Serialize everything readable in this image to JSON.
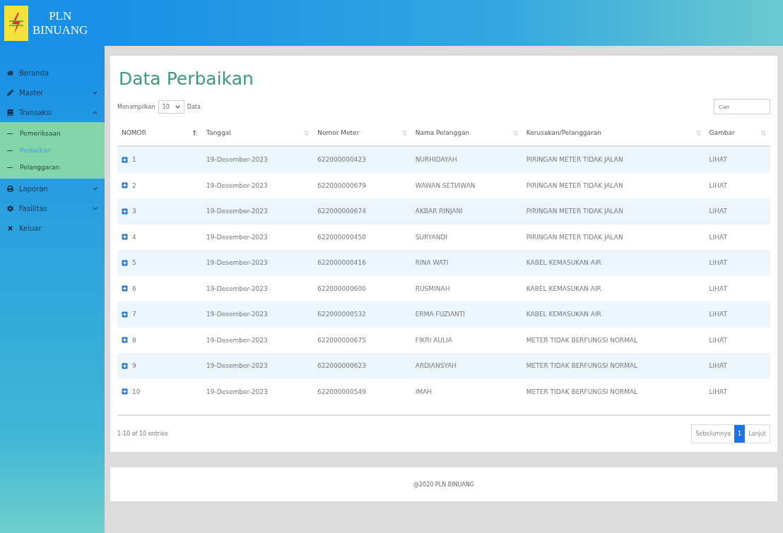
{
  "brand": {
    "line1": "PLN",
    "line2": "BINUANG"
  },
  "sidebar": {
    "items": [
      {
        "label": "Beranda"
      },
      {
        "label": "Master",
        "expanded": false
      },
      {
        "label": "Transaksi",
        "expanded": true,
        "children": [
          {
            "label": "Pemeriksaan",
            "selected": false
          },
          {
            "label": "Perbaikan",
            "selected": true
          },
          {
            "label": "Pelanggaran",
            "selected": false
          }
        ]
      },
      {
        "label": "Laporan",
        "expanded": false
      },
      {
        "label": "Fasilitas",
        "expanded": false
      },
      {
        "label": "Keluar"
      }
    ]
  },
  "page_title": "Data Perbaikan",
  "length_control": {
    "before": "Menampilkan",
    "value": "10",
    "after": "Data"
  },
  "search": {
    "placeholder": "Cari"
  },
  "table": {
    "columns": [
      {
        "label": "NOMOR",
        "sorted": true
      },
      {
        "label": "Tanggal",
        "sorted": false
      },
      {
        "label": "Nomor Meter",
        "sorted": false
      },
      {
        "label": "Nama Pelanggan",
        "sorted": false
      },
      {
        "label": "Kerusakan/Pelanggaran",
        "sorted": false
      },
      {
        "label": "Gambar",
        "sorted": false
      }
    ],
    "rows": [
      [
        "1",
        "19-Desember-2023",
        "622000000423",
        "NURHIDAYAH",
        "PIRINGAN METER TIDAK JALAN",
        "LIHAT"
      ],
      [
        "2",
        "19-Desember-2023",
        "622000000679",
        "WAWAN SETIAWAN",
        "PIRINGAN METER TIDAK JALAN",
        "LIHAT"
      ],
      [
        "3",
        "19-Desember-2023",
        "622000000674",
        "AKBAR RINJANI",
        "PIRINGAN METER TIDAK JALAN",
        "LIHAT"
      ],
      [
        "4",
        "19-Desember-2023",
        "622000000450",
        "SURYANDI",
        "PIRINGAN METER TIDAK JALAN",
        "LIHAT"
      ],
      [
        "5",
        "19-Desember-2023",
        "622000000416",
        "RINA WATI",
        "KABEL KEMASUKAN AIR",
        "LIHAT"
      ],
      [
        "6",
        "19-Desember-2023",
        "622000000600",
        "RUSMINAH",
        "KABEL KEMASUKAN AIR",
        "LIHAT"
      ],
      [
        "7",
        "19-Desember-2023",
        "622000000532",
        "ERMA FUZIANTI",
        "KABEL KEMASUKAN AIR",
        "LIHAT"
      ],
      [
        "8",
        "19-Desember-2023",
        "622000000675",
        "FIKRI AULIA",
        "METER TIDAK BERFUNGSI NORMAL",
        "LIHAT"
      ],
      [
        "9",
        "19-Desember-2023",
        "622000000623",
        "ARDIANSYAH",
        "METER TIDAK BERFUNGSI NORMAL",
        "LIHAT"
      ],
      [
        "10",
        "19-Desember-2023",
        "622000000549",
        "IMAH",
        "METER TIDAK BERFUNGSI NORMAL",
        "LIHAT"
      ]
    ]
  },
  "entries_info": "1-10 of 10 entries",
  "pagination": {
    "previous": "Sebelumnya",
    "pages": [
      {
        "label": "1",
        "selected": true
      }
    ],
    "next": "Lanjut"
  },
  "footer": "@2020 PLN BINUANG"
}
